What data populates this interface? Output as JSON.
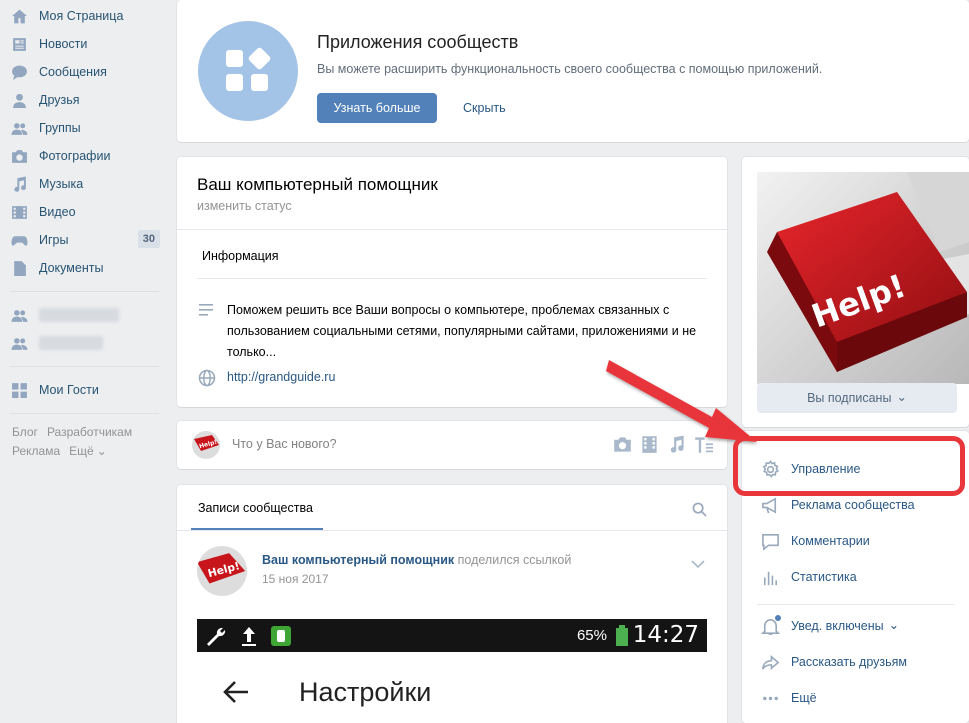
{
  "leftnav": {
    "items": [
      {
        "label": "Моя Страница",
        "icon": "home-icon"
      },
      {
        "label": "Новости",
        "icon": "news-icon"
      },
      {
        "label": "Сообщения",
        "icon": "messages-icon"
      },
      {
        "label": "Друзья",
        "icon": "friends-icon"
      },
      {
        "label": "Группы",
        "icon": "groups-icon"
      },
      {
        "label": "Фотографии",
        "icon": "camera-icon"
      },
      {
        "label": "Музыка",
        "icon": "music-icon"
      },
      {
        "label": "Видео",
        "icon": "video-icon"
      },
      {
        "label": "Игры",
        "icon": "gamepad-icon",
        "badge": "30"
      },
      {
        "label": "Документы",
        "icon": "document-icon"
      }
    ],
    "guests": "Мои Гости",
    "footer": [
      "Блог",
      "Разработчикам",
      "Реклама",
      "Ещё"
    ]
  },
  "banner": {
    "title": "Приложения сообществ",
    "description": "Вы можете расширить функциональность своего сообщества с помощью приложений.",
    "primary_button": "Узнать больше",
    "secondary_button": "Скрыть"
  },
  "community": {
    "name": "Ваш компьютерный помощник",
    "status_link": "изменить статус",
    "info_tab": "Информация",
    "description": "Поможем решить все Ваши вопросы о компьютере, проблемах связанных с пользованием социальными сетями, популярными сайтами, приложениями и не только...",
    "website": "http://grandguide.ru"
  },
  "newpost": {
    "placeholder": "Что у Вас нового?"
  },
  "wall": {
    "tab": "Записи сообщества",
    "post": {
      "author": "Ваш компьютерный помощник",
      "action": "поделился ссылкой",
      "date": "15 ноя 2017",
      "preview": {
        "battery": "65%",
        "time": "14:27",
        "title": "Настройки"
      }
    }
  },
  "sidebar": {
    "photo_text": "Help!",
    "subscribed_button": "Вы подписаны",
    "actions": [
      {
        "label": "Управление",
        "icon": "gear-icon"
      },
      {
        "label": "Реклама сообщества",
        "icon": "megaphone-icon"
      },
      {
        "label": "Комментарии",
        "icon": "comment-icon"
      },
      {
        "label": "Статистика",
        "icon": "stats-icon"
      },
      {
        "label": "Увед. включены",
        "icon": "bell-icon"
      },
      {
        "label": "Рассказать друзьям",
        "icon": "share-icon"
      },
      {
        "label": "Ещё",
        "icon": "more-icon"
      }
    ]
  },
  "colors": {
    "accent": "#5181b8",
    "link": "#2a5885",
    "highlight": "#e8363b",
    "background": "#edeef0"
  }
}
